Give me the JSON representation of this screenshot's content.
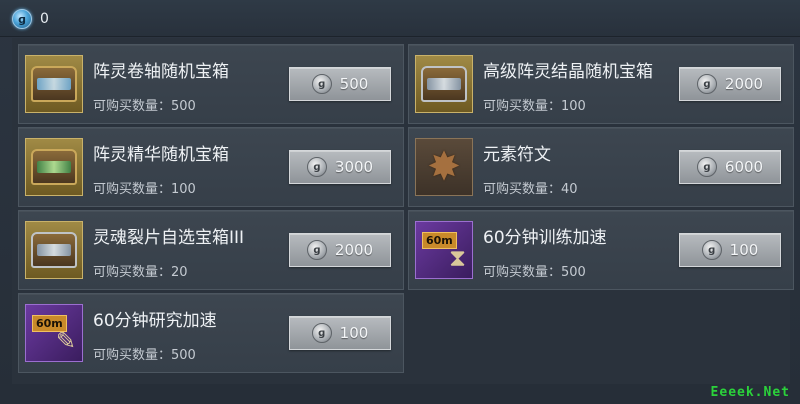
{
  "topbar": {
    "currency_value": "0",
    "currency_icon": "crystal-coin-icon"
  },
  "items": [
    {
      "name": "阵灵卷轴随机宝箱",
      "qty": "可购买数量：500",
      "price": "500",
      "icon": "chest-icon"
    },
    {
      "name": "高级阵灵结晶随机宝箱",
      "qty": "可购买数量：100",
      "price": "2000",
      "icon": "chest-icon"
    },
    {
      "name": "阵灵精华随机宝箱",
      "qty": "可购买数量：100",
      "price": "3000",
      "icon": "chest-icon"
    },
    {
      "name": "元素符文",
      "qty": "可购买数量：40",
      "price": "6000",
      "icon": "rune-star-icon"
    },
    {
      "name": "灵魂裂片自选宝箱III",
      "qty": "可购买数量：20",
      "price": "2000",
      "icon": "chest-icon"
    },
    {
      "name": "60分钟训练加速",
      "qty": "可购买数量：500",
      "price": "100",
      "icon": "speedup-icon",
      "tag": "60m"
    },
    {
      "name": "60分钟研究加速",
      "qty": "可购买数量：500",
      "price": "100",
      "icon": "speedup-icon",
      "tag": "60m"
    }
  ],
  "watermark": "Eeeek.Net"
}
